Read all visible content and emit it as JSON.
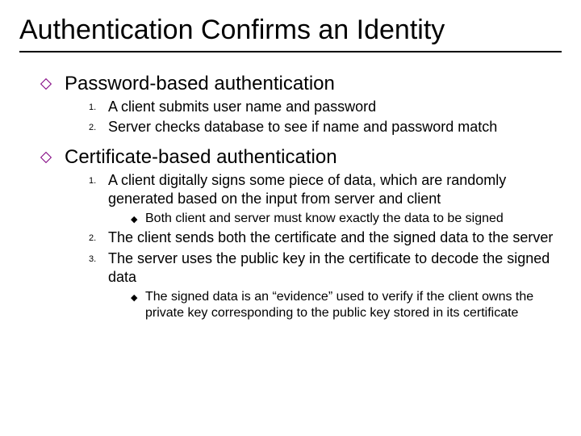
{
  "title": "Authentication Confirms an Identity",
  "sections": [
    {
      "heading": "Password-based authentication",
      "items": [
        {
          "text": "A client submits user name and password"
        },
        {
          "text": "Server checks database to see if name and password match"
        }
      ]
    },
    {
      "heading": "Certificate-based authentication",
      "items": [
        {
          "text": "A client digitally signs some piece of data, which are randomly generated based on the input from server and client",
          "sub": [
            "Both client and server must know exactly the data to be signed"
          ]
        },
        {
          "text": "The client sends both the certificate and the signed data to the server"
        },
        {
          "text": "The server uses the public key in the certificate to decode the signed data",
          "sub": [
            "The signed data is an “evidence” used to verify if the client owns the private key corresponding to the public key stored in its certificate"
          ]
        }
      ]
    }
  ]
}
